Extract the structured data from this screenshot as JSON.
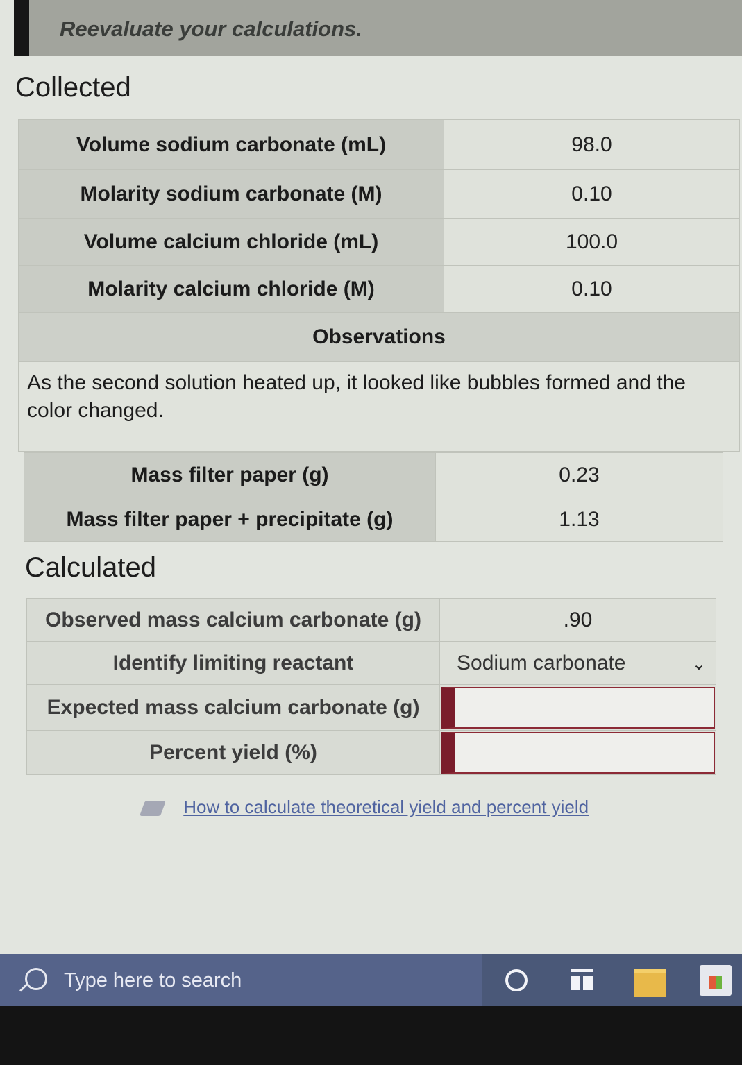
{
  "banner": {
    "message": "Reevaluate your calculations."
  },
  "collected": {
    "title": "Collected",
    "rows": [
      {
        "label": "Volume sodium carbonate (mL)",
        "value": "98.0"
      },
      {
        "label": "Molarity sodium carbonate (M)",
        "value": "0.10"
      },
      {
        "label": "Volume calcium chloride (mL)",
        "value": "100.0"
      },
      {
        "label": "Molarity calcium chloride (M)",
        "value": "0.10"
      }
    ],
    "observations_heading": "Observations",
    "observations_text": "As the second solution heated up, it looked like bubbles formed and the color changed.",
    "mass_rows": [
      {
        "label": "Mass filter paper (g)",
        "value": "0.23"
      },
      {
        "label": "Mass filter paper + precipitate (g)",
        "value": "1.13"
      }
    ]
  },
  "calculated": {
    "title": "Calculated",
    "observed_label": "Observed mass calcium carbonate (g)",
    "observed_value": ".90",
    "limiting_label": "Identify limiting reactant",
    "limiting_selected": "Sodium carbonate",
    "expected_label": "Expected mass calcium carbonate (g)",
    "expected_value": "",
    "yield_label": "Percent yield (%)",
    "yield_value": ""
  },
  "help_link": "How to calculate theoretical yield and percent yield",
  "taskbar": {
    "search_placeholder": "Type here to search"
  }
}
